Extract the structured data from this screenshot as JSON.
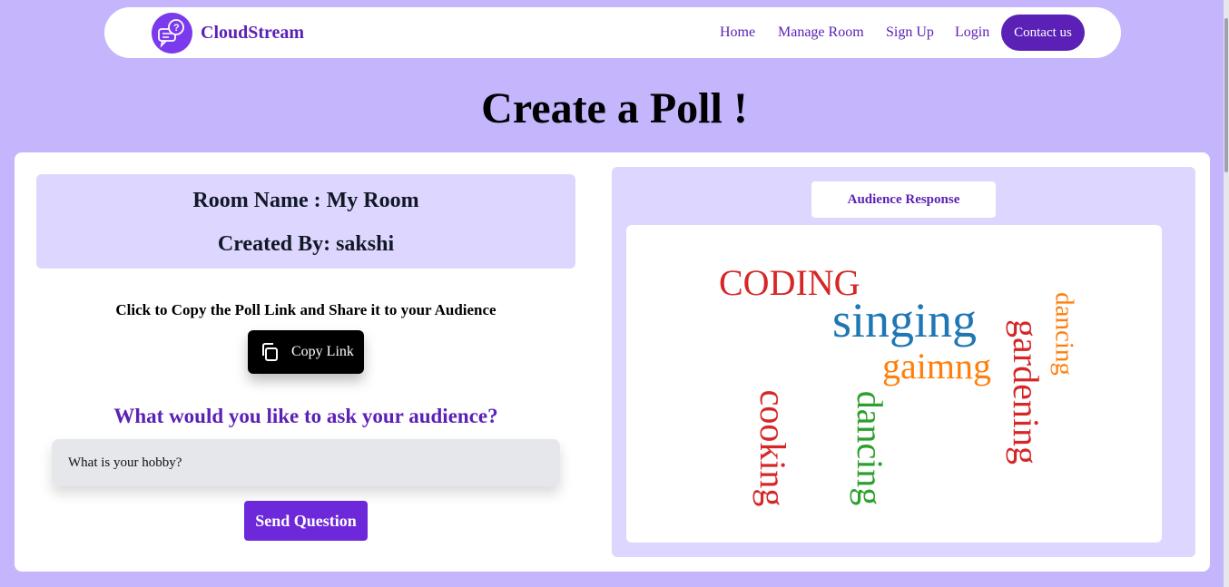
{
  "navbar": {
    "brand": "CloudStream",
    "links": [
      "Home",
      "Manage Room",
      "Sign Up",
      "Login"
    ],
    "contact": "Contact us"
  },
  "page_title": "Create a Poll !",
  "room": {
    "name_line": "Room Name : My Room",
    "created_line": "Created By: sakshi"
  },
  "share": {
    "instruction": "Click to Copy the Poll Link and Share it to your Audience",
    "copy_label": "Copy Link"
  },
  "question": {
    "heading": "What would you like to ask your audience?",
    "value": "What is your hobby?",
    "send_label": "Send Question"
  },
  "response": {
    "tab_label": "Audience Response",
    "words": [
      {
        "text": "CODING",
        "color": "#d62728"
      },
      {
        "text": "singing",
        "color": "#1f77b4"
      },
      {
        "text": "gaimng",
        "color": "#ff7f0e"
      },
      {
        "text": "dancing",
        "color": "#ff7f0e"
      },
      {
        "text": "gardening",
        "color": "#d62728"
      },
      {
        "text": "cooking",
        "color": "#d62728"
      },
      {
        "text": "dancing",
        "color": "#2ca02c"
      }
    ]
  }
}
